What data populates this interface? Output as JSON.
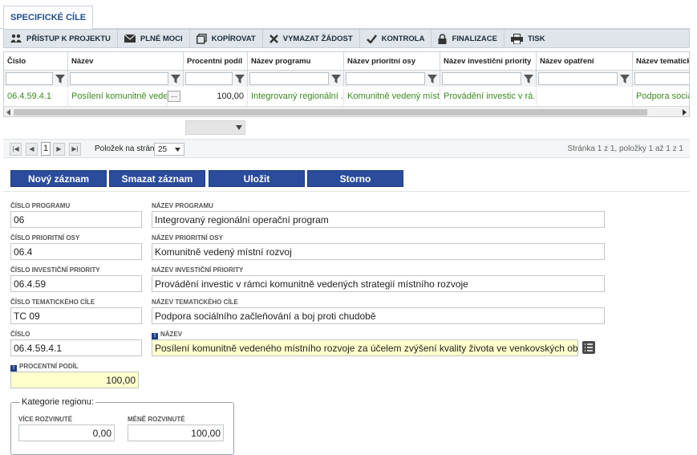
{
  "tab": {
    "label": "SPECIFICKÉ CÍLE"
  },
  "toolbar": {
    "items": [
      {
        "label": "PŘÍSTUP K PROJEKTU",
        "icon": "users-icon"
      },
      {
        "label": "PLNÉ MOCI",
        "icon": "envelope-icon"
      },
      {
        "label": "KOPÍROVAT",
        "icon": "copy-icon"
      },
      {
        "label": "VYMAZAT ŽÁDOST",
        "icon": "cross-icon"
      },
      {
        "label": "KONTROLA",
        "icon": "check-icon"
      },
      {
        "label": "FINALIZACE",
        "icon": "lock-icon"
      },
      {
        "label": "TISK",
        "icon": "printer-icon"
      }
    ]
  },
  "grid": {
    "columns": [
      "Číslo",
      "Název",
      "Procentní podíl",
      "Název programu",
      "Název prioritní osy",
      "Název investiční priority",
      "Název opatření",
      "Název tematického"
    ],
    "row": [
      "06.4.59.4.1",
      "Posílení komunitně vedeného",
      "100,00",
      "Integrovaný regionální ...",
      "Komunitně vedený míst...",
      "Provádění investic v rá...",
      "",
      "Podpora sociál"
    ],
    "more_button": "..."
  },
  "pager": {
    "page": "1",
    "per_page_label": "Položek na stránku",
    "per_page": "25",
    "info": "Stránka 1 z 1, položky 1 až 1 z 1"
  },
  "actions": {
    "new": "Nový záznam",
    "delete": "Smazat záznam",
    "save": "Uložit",
    "cancel": "Storno"
  },
  "form": {
    "cislo_programu_label": "ČÍSLO PROGRAMU",
    "cislo_programu": "06",
    "nazev_programu_label": "NÁZEV PROGRAMU",
    "nazev_programu": "Integrovaný regionální operační program",
    "cislo_osy_label": "ČÍSLO PRIORITNÍ OSY",
    "cislo_osy": "06.4",
    "nazev_osy_label": "NÁZEV PRIORITNÍ OSY",
    "nazev_osy": "Komunitně vedený místní rozvoj",
    "cislo_priority_label": "ČÍSLO INVESTIČNÍ PRIORITY",
    "cislo_priority": "06.4.59",
    "nazev_priority_label": "NÁZEV INVESTIČNÍ PRIORITY",
    "nazev_priority": "Provádění investic v rámci komunitně vedených strategií místního rozvoje",
    "cislo_cile_label": "ČÍSLO TEMATICKÉHO CÍLE",
    "cislo_cile": "TC 09",
    "nazev_cile_label": "NÁZEV TEMATICKÉHO CÍLE",
    "nazev_cile": "Podpora sociálního začleňování a boj proti chudobě",
    "cislo_label": "ČÍSLO",
    "cislo": "06.4.59.4.1",
    "nazev_label": "NÁZEV",
    "nazev": "Posílení komunitně vedeného místního rozvoje za účelem zvýšení kvality života ve venkovských oblastech a aktiviz...",
    "podil_label": "PROCENTNÍ PODÍL",
    "podil": "100,00",
    "kategorie_label": "Kategorie regionu:",
    "vice_label": "VÍCE ROZVINUTÉ",
    "vice": "0,00",
    "mene_label": "MÉNĚ ROZVINUTÉ",
    "mene": "100,00",
    "required_mark": "!"
  }
}
